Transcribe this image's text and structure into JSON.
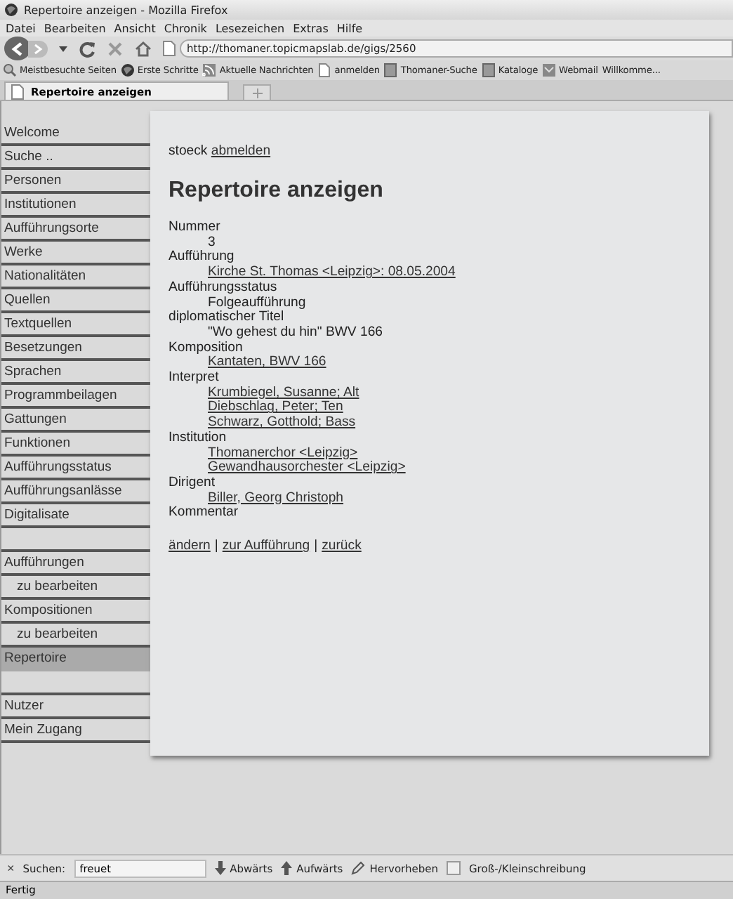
{
  "window": {
    "title": "Repertoire anzeigen - Mozilla Firefox"
  },
  "menu": [
    "Datei",
    "Bearbeiten",
    "Ansicht",
    "Chronik",
    "Lesezeichen",
    "Extras",
    "Hilfe"
  ],
  "address": {
    "value": "http://thomaner.topicmapslab.de/gigs/2560"
  },
  "bookmarks": [
    {
      "label": "Meistbesuchte Seiten",
      "kind": "search"
    },
    {
      "label": "Erste Schritte",
      "kind": "globe"
    },
    {
      "label": "Aktuelle Nachrichten",
      "kind": "feed"
    },
    {
      "label": "anmelden",
      "kind": "page"
    },
    {
      "label": "Thomaner-Suche",
      "kind": "book"
    },
    {
      "label": "Kataloge",
      "kind": "book"
    },
    {
      "label": "Webmail",
      "kind": "mail"
    },
    {
      "label": "Willkomme...",
      "kind": "none"
    }
  ],
  "tabs": [
    {
      "label": "Repertoire anzeigen",
      "selected": true
    }
  ],
  "sidebar": {
    "groups": [
      {
        "items": [
          {
            "label": "Welcome",
            "kind": "item",
            "selected": false
          },
          {
            "label": "Suche ..",
            "kind": "item",
            "selected": false
          },
          {
            "label": "Personen",
            "kind": "item",
            "selected": false
          },
          {
            "label": "Institutionen",
            "kind": "item",
            "selected": false
          },
          {
            "label": "Aufführungsorte",
            "kind": "item",
            "selected": false
          },
          {
            "label": "Werke",
            "kind": "item",
            "selected": false
          },
          {
            "label": "Nationalitäten",
            "kind": "item",
            "selected": false
          },
          {
            "label": "Quellen",
            "kind": "item",
            "selected": false
          },
          {
            "label": "Textquellen",
            "kind": "item",
            "selected": false
          },
          {
            "label": "Besetzungen",
            "kind": "item",
            "selected": false
          },
          {
            "label": "Sprachen",
            "kind": "item",
            "selected": false
          },
          {
            "label": "Programmbeilagen",
            "kind": "item",
            "selected": false
          },
          {
            "label": "Gattungen",
            "kind": "item",
            "selected": false
          },
          {
            "label": "Funktionen",
            "kind": "item",
            "selected": false
          },
          {
            "label": "Aufführungsstatus",
            "kind": "item",
            "selected": false
          },
          {
            "label": "Aufführungsanlässe",
            "kind": "item",
            "selected": false
          },
          {
            "label": "Digitalisate",
            "kind": "item",
            "selected": false
          }
        ]
      },
      {
        "items": [
          {
            "label": "Aufführungen",
            "kind": "item",
            "selected": false
          },
          {
            "label": "zu bearbeiten",
            "kind": "sub",
            "selected": false
          },
          {
            "label": "Kompositionen",
            "kind": "item",
            "selected": false
          },
          {
            "label": "zu bearbeiten",
            "kind": "sub",
            "selected": false
          },
          {
            "label": "Repertoire",
            "kind": "item",
            "selected": true
          }
        ]
      },
      {
        "items": [
          {
            "label": "Nutzer",
            "kind": "item",
            "selected": false
          },
          {
            "label": "Mein Zugang",
            "kind": "item",
            "selected": false
          }
        ]
      }
    ]
  },
  "user": {
    "name": "stoeck",
    "logout": "abmelden"
  },
  "heading": "Repertoire anzeigen",
  "fields": [
    {
      "label": "Nummer",
      "values": [
        {
          "text": "3",
          "link": false
        }
      ]
    },
    {
      "label": "Aufführung",
      "values": [
        {
          "text": "Kirche St. Thomas <Leipzig>: 08.05.2004",
          "link": true
        }
      ]
    },
    {
      "label": "Aufführungsstatus",
      "values": [
        {
          "text": "Folgeaufführung",
          "link": false
        }
      ]
    },
    {
      "label": "diplomatischer Titel",
      "values": [
        {
          "text": "\"Wo gehest du hin\" BWV 166",
          "link": false
        }
      ]
    },
    {
      "label": "Komposition",
      "values": [
        {
          "text": "Kantaten, BWV 166",
          "link": true
        }
      ]
    },
    {
      "label": "Interpret",
      "values": [
        {
          "text": "Krumbiegel, Susanne; Alt",
          "link": true
        },
        {
          "text": "Diebschlag, Peter; Ten",
          "link": true
        },
        {
          "text": "Schwarz, Gotthold; Bass",
          "link": true
        }
      ]
    },
    {
      "label": "Institution",
      "values": [
        {
          "text": "Thomanerchor <Leipzig>",
          "link": true
        },
        {
          "text": "Gewandhausorchester <Leipzig>",
          "link": true
        }
      ]
    },
    {
      "label": "Dirigent",
      "values": [
        {
          "text": "Biller, Georg Christoph",
          "link": true
        }
      ]
    },
    {
      "label": "Kommentar"
    }
  ],
  "actions": [
    {
      "label": "ändern",
      "separator": "|"
    },
    {
      "label": "zur Aufführung",
      "separator": "|"
    },
    {
      "label": "zurück"
    }
  ],
  "findbar": {
    "close": "×",
    "label": "Suchen:",
    "value": "freuet",
    "down": "Abwärts",
    "up": "Aufwärts",
    "highlight": "Hervorheben",
    "case": {
      "label": "Groß-/Kleinschreibung",
      "checked": false
    }
  },
  "status_bar": "Fertig"
}
